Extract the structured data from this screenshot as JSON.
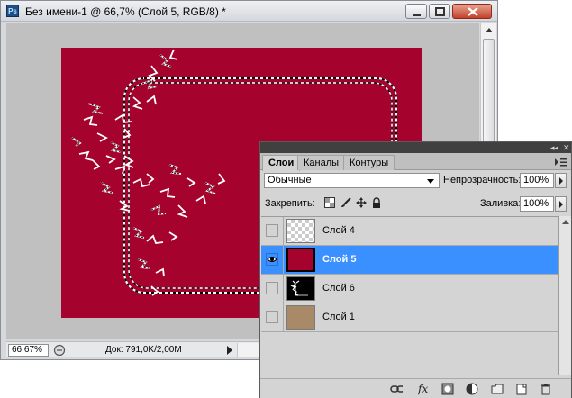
{
  "document": {
    "title": "Без имени-1 @ 66,7% (Слой 5, RGB/8) *",
    "app_icon": "Ps",
    "artboard_color": "#a5032e",
    "canvas_bg": "#c0c0c0"
  },
  "window_controls": {
    "minimize": "minimize-icon",
    "maximize": "maximize-icon",
    "close": "close-icon"
  },
  "status": {
    "zoom": "66,67%",
    "doc_info": "Док: 791,0K/2,00M"
  },
  "panel": {
    "tabs": [
      {
        "label": "Слои",
        "active": true
      },
      {
        "label": "Каналы",
        "active": false
      },
      {
        "label": "Контуры",
        "active": false
      }
    ],
    "blend_mode": "Обычные",
    "opacity_label": "Непрозрачность:",
    "opacity_value": "100%",
    "lock_label": "Закрепить:",
    "fill_label": "Заливка:",
    "fill_value": "100%",
    "layers": [
      {
        "name": "Слой 4",
        "visible": false,
        "selected": false,
        "thumb": "transparent"
      },
      {
        "name": "Слой 5",
        "visible": true,
        "selected": true,
        "thumb": "#a5032e"
      },
      {
        "name": "Слой 6",
        "visible": false,
        "selected": false,
        "thumb": "black-with-white-shape"
      },
      {
        "name": "Слой 1",
        "visible": false,
        "selected": false,
        "thumb": "#a88a68"
      }
    ],
    "selection_color": "#3b90ff"
  }
}
